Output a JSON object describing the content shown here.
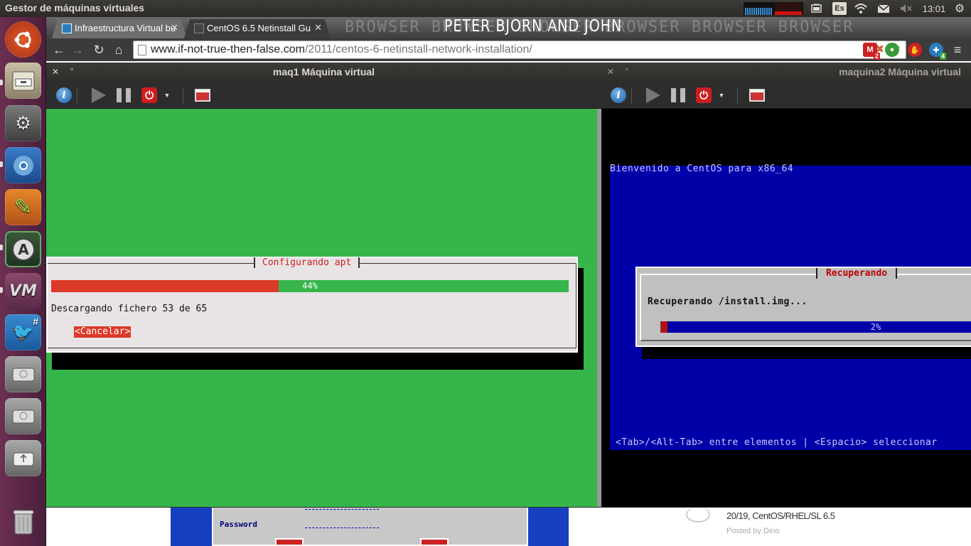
{
  "top_panel": {
    "window_title": "Gestor de máquinas virtuales",
    "keyboard_layout": "Es",
    "clock": "13:01"
  },
  "browser": {
    "tabs": [
      {
        "title": "Infraestructura Virtual bu",
        "active": false
      },
      {
        "title": "CentOS 6.5 Netinstall Gu",
        "active": true
      }
    ],
    "banner_faded": "BROWSER BROWSER BROWSER BROWSER BROWSER BROWSER",
    "banner_strong": "PETER BJORN AND JOHN",
    "url_domain": "www.if-not-true-then-false.com",
    "url_path": "/2011/centos-6-netinstall-network-installation/",
    "extension_badges": {
      "gmail": "2",
      "globe": "4"
    },
    "page": {
      "password_label": "Password",
      "post_meta": "20/19, CentOS/RHEL/SL 6.5",
      "posted_by": "Posted by Dino"
    }
  },
  "vm1": {
    "title": "maq1 Máquina virtual",
    "dialog_title": "Configurando apt",
    "progress": 0.44,
    "progress_label": "44%",
    "message": "Descargando fichero 53 de 65",
    "cancel_label": "<Cancelar>",
    "colors": {
      "background": "#36b54a",
      "progress": "#dc3a28",
      "dialog": "#e8e4e6"
    }
  },
  "vm2": {
    "title": "maquina2 Máquina virtual",
    "welcome": "Bienvenido a CentOS para x86_64",
    "dialog_title": "Recuperando",
    "message": "Recuperando /install.img...",
    "progress": 0.02,
    "progress_label": "2%",
    "hint": "<Tab>/<Alt-Tab> entre elementos  |  <Espacio> seleccionar",
    "colors": {
      "background": "#0000a8",
      "dialog": "#c0c0c0",
      "progress": "#b81010"
    }
  },
  "toolbar_icons": [
    "info-icon",
    "play-icon",
    "pause-icon",
    "power-icon",
    "dropdown-icon",
    "screenshot-icon"
  ],
  "launcher_icons": [
    "ubuntu-dash-icon",
    "file-manager-icon",
    "system-settings-icon",
    "chromium-icon",
    "pencil-editor-icon",
    "software-updater-icon",
    "virt-manager-icon",
    "twitter-client-icon",
    "drive-icon",
    "drive-icon",
    "usb-drive-icon",
    "trash-icon"
  ]
}
